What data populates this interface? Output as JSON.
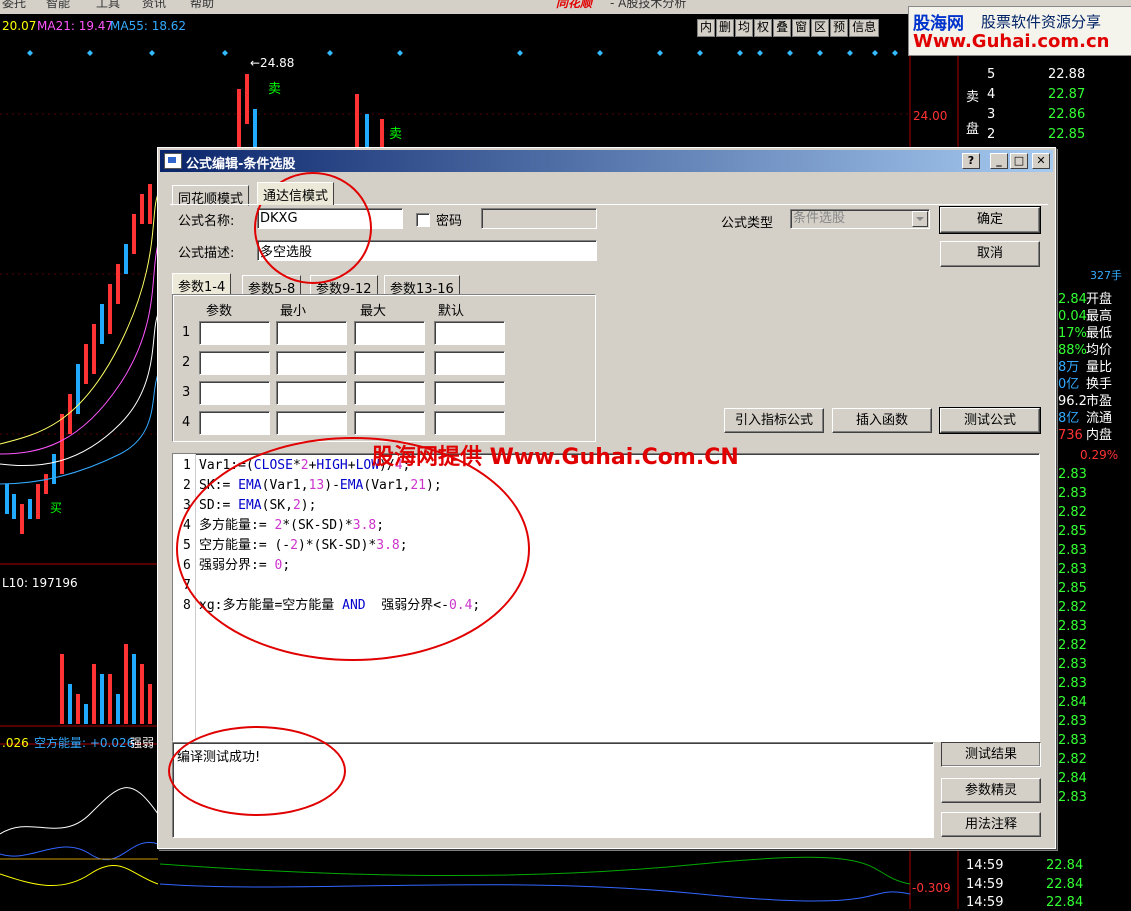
{
  "menubar": {
    "items": [
      "委托",
      "智能",
      "工具",
      "资讯",
      "帮助"
    ],
    "app_logo": "同花顺",
    "app_title": "- A股技术分析"
  },
  "chart": {
    "ma_values": [
      {
        "label": "20.07",
        "color": "#ffff00"
      },
      {
        "label": "MA21: 19.47",
        "color": "#ff55ff"
      },
      {
        "label": "MA55: 18.62",
        "color": "#33aaff"
      }
    ],
    "high_label": "←24.88",
    "sell_label_1": "卖",
    "sell_label_2": "卖",
    "price_right": "24.00",
    "bottom_left_value": "L10: 197196",
    "ind_left": ".026",
    "ind_label": "空方能量: +0.026",
    "ind_label2": "强弱",
    "ind_bottom_value": "-0.309",
    "buy_mark": "买"
  },
  "toolbar": {
    "items": [
      "内",
      "删",
      "均",
      "权",
      "叠",
      "窗",
      "区",
      "预",
      "信息"
    ]
  },
  "watermark": {
    "brand": "股海网",
    "slogan": "股票软件资源分享",
    "url": "Www.Guhai.com.cn"
  },
  "right_panel": {
    "sell_orders": [
      {
        "level": "5",
        "price": "22.88"
      },
      {
        "level": "4",
        "price": "22.87"
      },
      {
        "level": "3",
        "price": "22.86"
      },
      {
        "level": "2",
        "price": "22.85"
      }
    ],
    "sell_side_label": [
      "卖",
      "盘"
    ],
    "vol_text": "327手",
    "stats": [
      {
        "val": "2.84",
        "key": "开盘"
      },
      {
        "val": "0.04",
        "key": "最高"
      },
      {
        "val": "17%",
        "key": "最低"
      },
      {
        "val": "88%",
        "key": "均价"
      },
      {
        "val": "8万",
        "key": "量比"
      },
      {
        "val": "0亿",
        "key": "换手"
      },
      {
        "val": "96.2",
        "key": "市盈"
      },
      {
        "val": "8亿",
        "key": "流通"
      },
      {
        "val": "736",
        "key": "内盘"
      }
    ],
    "pct": "0.29%",
    "ticks": [
      "2.83",
      "2.83",
      "2.82",
      "2.85",
      "2.83",
      "2.83",
      "2.85",
      "2.82",
      "2.83",
      "2.82",
      "2.83",
      "2.83",
      "2.84",
      "2.83",
      "2.83",
      "2.82",
      "2.84",
      "2.83"
    ],
    "times": [
      "14:59",
      "14:59",
      "14:59"
    ],
    "last_prices": [
      "22.84",
      "22.84",
      "22.84"
    ]
  },
  "dialog": {
    "title": "公式编辑-条件选股",
    "help_btn": "?",
    "tabs": [
      "同花顺模式",
      "通达信模式"
    ],
    "name_label": "公式名称:",
    "name_value": "DKXG",
    "password_label": "密码",
    "desc_label": "公式描述:",
    "desc_value": "多空选股",
    "type_label": "公式类型",
    "type_value": "条件选股",
    "ok": "确定",
    "cancel": "取消",
    "param_tabs": [
      "参数1-4",
      "参数5-8",
      "参数9-12",
      "参数13-16"
    ],
    "param_headers": [
      "参数",
      "最小",
      "最大",
      "默认"
    ],
    "param_rows": [
      "1",
      "2",
      "3",
      "4"
    ],
    "import_btn": "引入指标公式",
    "insert_btn": "插入函数",
    "test_btn": "测试公式",
    "code_lines": [
      {
        "n": "1",
        "text": "Var1:=(CLOSE*2+HIGH+LOW)/4;"
      },
      {
        "n": "2",
        "text": "SK:= EMA(Var1,13)-EMA(Var1,21);"
      },
      {
        "n": "3",
        "text": "SD:= EMA(SK,2);"
      },
      {
        "n": "4",
        "text": "多方能量:= 2*(SK-SD)*3.8;"
      },
      {
        "n": "5",
        "text": "空方能量:= (-2)*(SK-SD)*3.8;"
      },
      {
        "n": "6",
        "text": "强弱分界:= 0;"
      },
      {
        "n": "7",
        "text": ""
      },
      {
        "n": "8",
        "text": "xg:多方能量=空方能量 AND  强弱分界<-0.4;"
      }
    ],
    "output_text": "编译测试成功!",
    "result_btn": "测试结果",
    "wizard_btn": "参数精灵",
    "usage_btn": "用法注释"
  },
  "overlay": {
    "guhai_text": "股海网提供 Www.Guhai.Com.CN"
  }
}
